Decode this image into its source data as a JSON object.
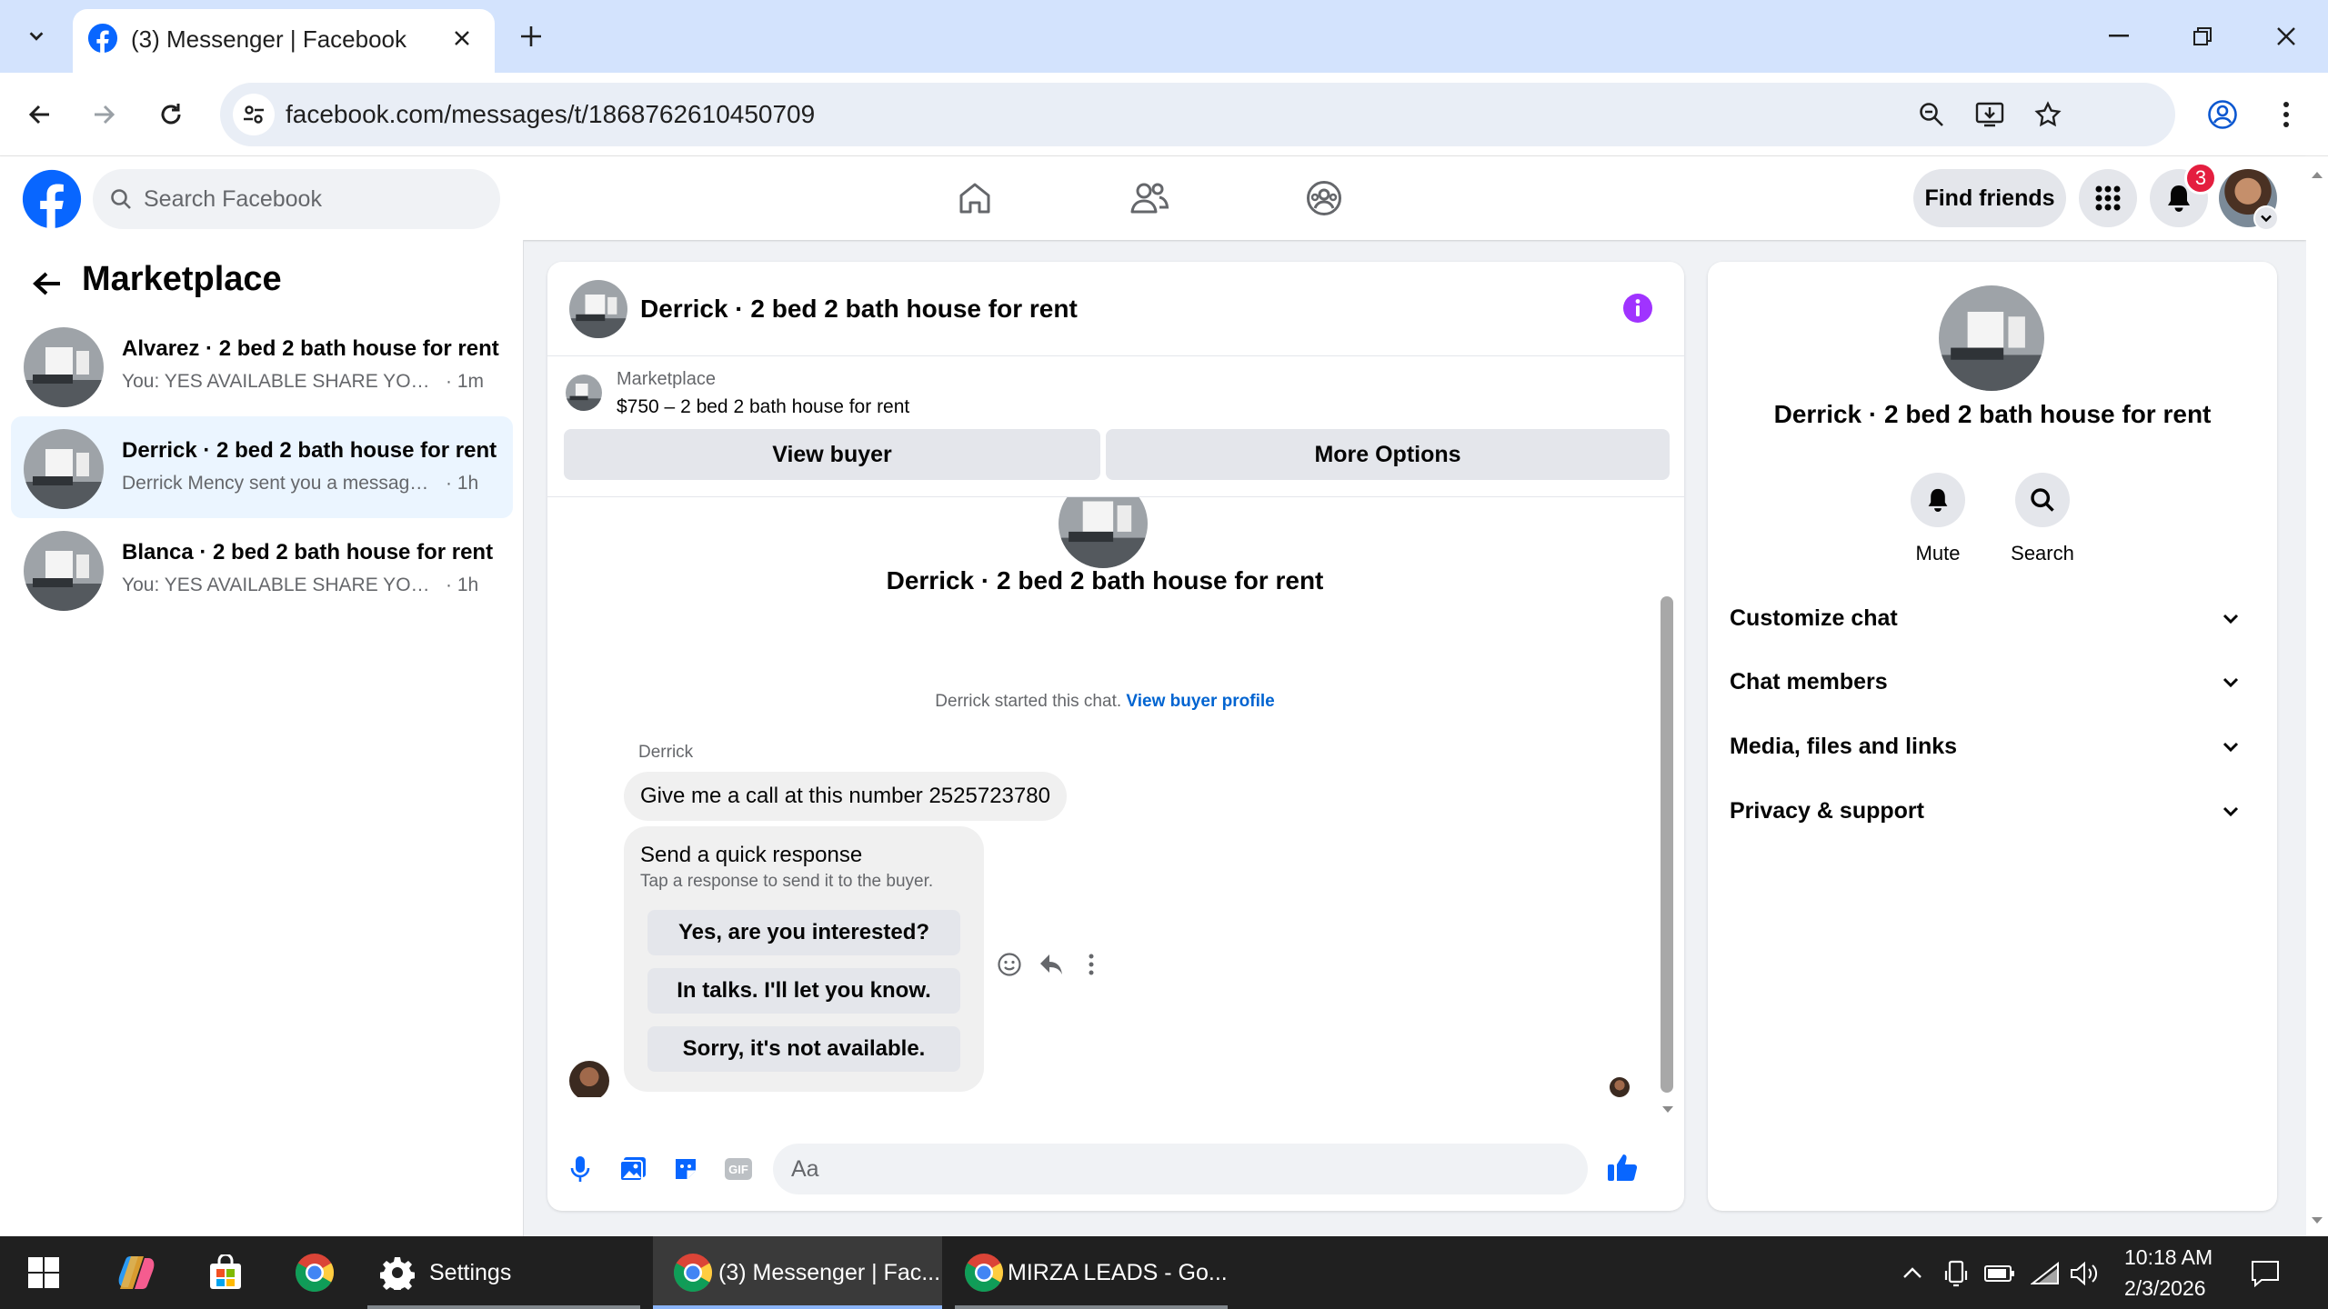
{
  "browser": {
    "tab_title": "(3) Messenger | Facebook",
    "url": "facebook.com/messages/t/1868762610450709"
  },
  "fb_header": {
    "search_placeholder": "Search Facebook",
    "find_friends_label": "Find friends",
    "notification_count": "3"
  },
  "sidebar": {
    "title": "Marketplace",
    "conversations": [
      {
        "name": "Alvarez · 2 bed 2 bath house for rent",
        "preview": "You: YES AVAILABLE SHARE YOUR NUMBER",
        "time": "· 1m",
        "active": false
      },
      {
        "name": "Derrick · 2 bed 2 bath house for rent",
        "preview": "Derrick Mency sent you a message about your listing",
        "time": "· 1h",
        "active": true
      },
      {
        "name": "Blanca · 2 bed 2 bath house for rent",
        "preview": "You: YES AVAILABLE SHARE YOUR NUMBER",
        "time": "· 1h",
        "active": false
      }
    ]
  },
  "chat": {
    "title": "Derrick · 2 bed 2 bath house for rent",
    "listing_label": "Marketplace",
    "listing_title": "$750 – 2 bed 2 bath house for rent",
    "view_buyer_label": "View buyer",
    "more_options_label": "More Options",
    "thread_title": "Derrick · 2 bed 2 bath house for rent",
    "started_text": "Derrick started this chat.",
    "started_link": "View buyer profile",
    "sender_name": "Derrick",
    "message": "Give me a call at this number 2525723780",
    "quick_title": "Send a quick response",
    "quick_subtitle": "Tap a response to send it to the buyer.",
    "quick_responses": [
      "Yes, are you interested?",
      "In talks. I'll let you know.",
      "Sorry, it's not available."
    ],
    "composer_placeholder": "Aa"
  },
  "info_panel": {
    "title": "Derrick · 2 bed 2 bath house for rent",
    "mute_label": "Mute",
    "search_label": "Search",
    "sections": [
      "Customize chat",
      "Chat members",
      "Media, files and links",
      "Privacy & support"
    ]
  },
  "taskbar": {
    "settings_label": "Settings",
    "app1_label": "(3) Messenger | Fac...",
    "app2_label": "MIRZA LEADS - Go...",
    "time": "10:18 AM",
    "date": "2/3/2026"
  },
  "colors": {
    "fb_blue": "#0866ff",
    "messenger_purple": "#a033ff",
    "link_blue": "#0064d1",
    "badge_red": "#e41e3f",
    "active_conv_bg": "#ebf5ff"
  }
}
